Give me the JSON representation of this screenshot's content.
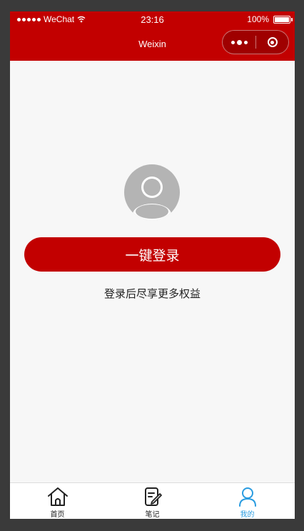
{
  "status_bar": {
    "carrier": "WeChat",
    "time": "23:16",
    "battery": "100%"
  },
  "nav": {
    "title": "Weixin"
  },
  "main": {
    "login_button": "一键登录",
    "hint": "登录后尽享更多权益"
  },
  "tabs": [
    {
      "label": "首页",
      "icon": "home-icon"
    },
    {
      "label": "笔记",
      "icon": "note-icon"
    },
    {
      "label": "我的",
      "icon": "user-icon",
      "active": true
    }
  ],
  "colors": {
    "brand": "#c20000",
    "active_tab": "#2a9ce0",
    "background": "#f7f7f7"
  }
}
